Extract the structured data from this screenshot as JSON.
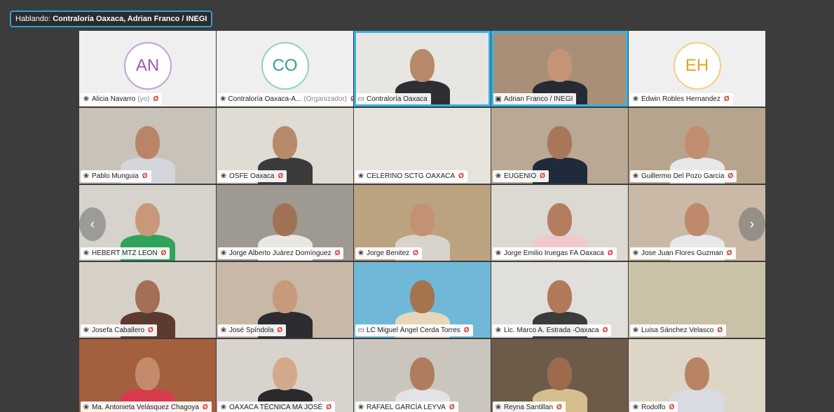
{
  "speaking": {
    "prefix": "Hablando:",
    "names": "Contraloría Oaxaca, Adrian Franco / INEGI"
  },
  "nav": {
    "prev_icon": "‹",
    "next_icon": "›"
  },
  "participants": [
    {
      "name": "Alicia Navarro",
      "role": "(yo)",
      "initials": "AN",
      "avatar_color": "purple",
      "icon": "mic-icon"
    },
    {
      "name": "Contraloría Oaxaca-A...",
      "role": "(Organizador)",
      "initials": "CO",
      "avatar_color": "teal",
      "icon": "mic-icon"
    },
    {
      "name": "Contraloría Oaxaca",
      "role": "",
      "icon": "room-icon",
      "active": true,
      "bg": "#e8e6e2",
      "shirt": "#2e2f33",
      "skin": "#b7896a"
    },
    {
      "name": "Adrian Franco / INEGI",
      "role": "",
      "icon": "screen-icon",
      "active": true,
      "bg": "#a98f77",
      "shirt": "#252a35",
      "skin": "#c79478"
    },
    {
      "name": "Edwin Robles Hernandez",
      "role": "",
      "initials": "EH",
      "avatar_color": "gold",
      "icon": "mic-icon"
    },
    {
      "name": "Pablo Munguia",
      "role": "",
      "icon": "mic-icon",
      "bg": "#c8c2b8",
      "shirt": "#d4d6dc",
      "skin": "#b98566"
    },
    {
      "name": "OSFE Oaxaca",
      "role": "",
      "icon": "mic-icon",
      "bg": "#dfdcd3",
      "shirt": "#3b3b3b",
      "skin": "#b88a6c"
    },
    {
      "name": "CELERINO SCTG OAXACA",
      "role": "",
      "icon": "mic-icon",
      "bg": "#e6e3dc",
      "shirt": "#e6e3dc",
      "skin": "#e6e3dc"
    },
    {
      "name": "EUGENIO",
      "role": "",
      "icon": "mic-icon",
      "bg": "#b9a894",
      "shirt": "#1f2a3a",
      "skin": "#a87659"
    },
    {
      "name": "Guillermo Del Pozo Garcia",
      "role": "",
      "icon": "mic-icon",
      "bg": "#b7a48c",
      "shirt": "#e8e8ea",
      "skin": "#c18e6f"
    },
    {
      "name": "HEBERT MTZ LEON",
      "role": "",
      "icon": "mic-icon",
      "bg": "#d6d3cd",
      "shirt": "#2fa35a",
      "skin": "#c9977a"
    },
    {
      "name": "Jorge Alberto Juárez Domínguez",
      "role": "",
      "icon": "mic-icon",
      "bg": "#9e9a92",
      "shirt": "#e9e7e2",
      "skin": "#a27257"
    },
    {
      "name": "Jorge Benitez",
      "role": "",
      "icon": "mic-icon",
      "bg": "#bca37f",
      "shirt": "#d9d4cb",
      "skin": "#c39274"
    },
    {
      "name": "Jorge Emilio Iruegas FA Oaxaca",
      "role": "",
      "icon": "mic-icon",
      "bg": "#dcd8d2",
      "shirt": "#f1c7cf",
      "skin": "#b47d60"
    },
    {
      "name": "Jose Juan Flores Guzman",
      "role": "",
      "icon": "mic-icon",
      "bg": "#c9b9a6",
      "shirt": "#e6e8ec",
      "skin": "#be8a6b"
    },
    {
      "name": "Josefa Caballero",
      "role": "",
      "icon": "mic-icon",
      "bg": "#d7d0c6",
      "shirt": "#5b3b2f",
      "skin": "#a36f55"
    },
    {
      "name": "José Spíndola",
      "role": "",
      "icon": "mic-icon",
      "bg": "#c7b8a8",
      "shirt": "#2c2d30",
      "skin": "#c9997c"
    },
    {
      "name": "LC Miguel Ángel Cerda Torres",
      "role": "",
      "icon": "room-icon",
      "bg": "#6fb8d8",
      "shirt": "#e5d7b9",
      "skin": "#a6734f"
    },
    {
      "name": "Lic. Marco A. Estrada -Oaxaca",
      "role": "",
      "icon": "mic-icon",
      "bg": "#e1dfdb",
      "shirt": "#3c3a3a",
      "skin": "#b0795a"
    },
    {
      "name": "Luisa Sánchez Velasco",
      "role": "",
      "icon": "mic-icon",
      "bg": "#c9c2a7",
      "shirt": "#c9c2a7",
      "skin": "#c9c2a7"
    },
    {
      "name": "Ma. Antonieta Velásquez Chagoya",
      "role": "",
      "icon": "mic-icon",
      "bg": "#a45f3f",
      "shirt": "#d83b4b",
      "skin": "#c38b6c"
    },
    {
      "name": "OAXACA TÉCNICA MA JOSÉ",
      "role": "",
      "icon": "mic-icon",
      "bg": "#d8d4cd",
      "shirt": "#2a2a2c",
      "skin": "#d3a98c"
    },
    {
      "name": "RAFAEL GARCÍA LEYVA",
      "role": "",
      "icon": "mic-icon",
      "bg": "#cbc6bd",
      "shirt": "#e2e3e6",
      "skin": "#b07c5e"
    },
    {
      "name": "Reyna Santillan",
      "role": "",
      "icon": "mic-icon",
      "bg": "#6d5b4a",
      "shirt": "#d6bf8e",
      "skin": "#9d6a4e"
    },
    {
      "name": "Rodolfo",
      "role": "",
      "icon": "mic-icon",
      "bg": "#ddd6c7",
      "shirt": "#d8dbe2",
      "skin": "#b98464"
    }
  ]
}
